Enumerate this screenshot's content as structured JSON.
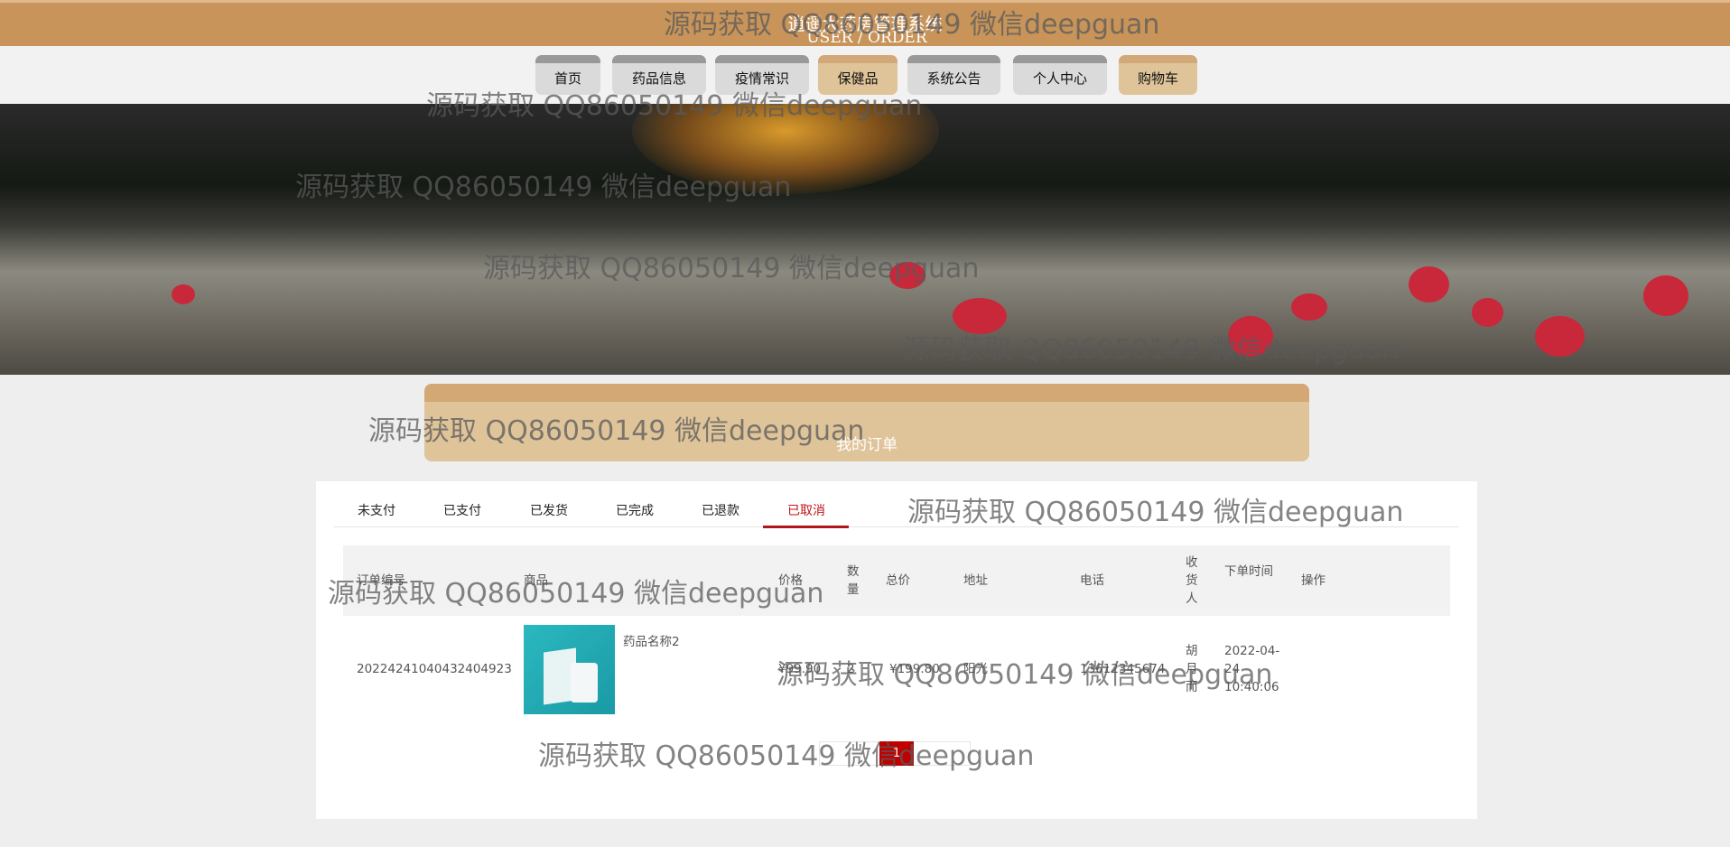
{
  "header": {
    "title": "逍遥大药房管理系统"
  },
  "nav": [
    {
      "label": "首页",
      "active": false
    },
    {
      "label": "药品信息",
      "active": false
    },
    {
      "label": "疫情常识",
      "active": false
    },
    {
      "label": "保健品",
      "active": true
    },
    {
      "label": "系统公告",
      "active": false
    },
    {
      "label": "个人中心",
      "active": false
    },
    {
      "label": "购物车",
      "active": true
    }
  ],
  "order_header": {
    "en": "USER / ORDER",
    "cn": "我的订单"
  },
  "tabs": [
    {
      "label": "未支付"
    },
    {
      "label": "已支付"
    },
    {
      "label": "已发货"
    },
    {
      "label": "已完成"
    },
    {
      "label": "已退款"
    },
    {
      "label": "已取消",
      "active": true
    }
  ],
  "table": {
    "headers": {
      "order_no": "订单编号",
      "product": "商品",
      "price": "价格",
      "qty": "数量",
      "total": "总价",
      "address": "地址",
      "phone": "电话",
      "receiver": "收货人",
      "time": "下单时间",
      "action": "操作"
    },
    "rows": [
      {
        "order_no": "20224241040432404923",
        "product_name": "药品名称2",
        "price": "¥99.90",
        "qty": "2",
        "total": "¥199.80",
        "address": "阳光",
        "phone": "13612345674",
        "receiver": "胡月而",
        "time": "2022-04-24 10:40:06"
      }
    ]
  },
  "pagination": {
    "current": "1"
  },
  "watermark": "源码获取 QQ86050149 微信deepguan",
  "colors": {
    "brand": "#c8945a",
    "active_tab": "#c0151b",
    "page_active": "#c00000"
  }
}
